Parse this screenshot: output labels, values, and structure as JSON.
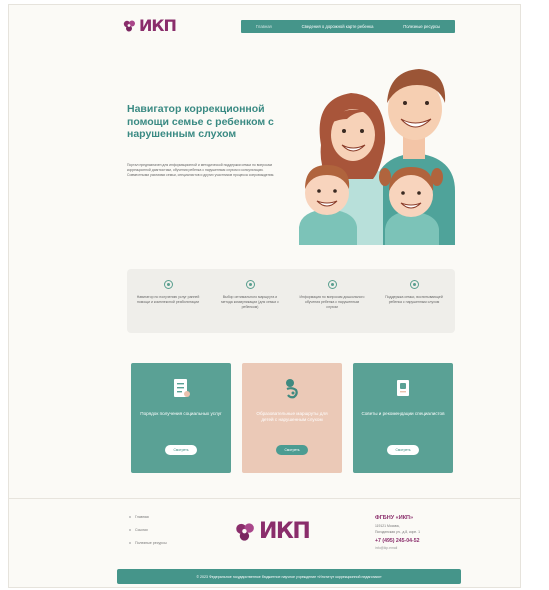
{
  "header": {
    "logo_text": "ИКП",
    "nav": [
      "Главная",
      "Сведения о дорожной карте ребенка",
      "Полезные ресурсы"
    ]
  },
  "hero": {
    "title": "Навигатор коррекционной помощи семье с ребенком с нарушенным слухом",
    "description": "Портал предназначен для информационной и методической поддержки семьи по вопросам коррекционной диагностики, обучения ребенка с нарушенным слухом и консультации. Совместными усилиями семьи, специалистов и других участников процесса сопровождения."
  },
  "features": [
    {
      "icon": "circle-check-icon",
      "text": "Навигатор по получению услуг ранней помощи и комплексной реабилитации"
    },
    {
      "icon": "circle-check-icon",
      "text": "Выбор оптимального маршрута и метода коммуникации (для семьи с ребенком)"
    },
    {
      "icon": "circle-check-icon",
      "text": "Информация по вопросам дошкольного обучения ребенка с нарушенным слухом"
    },
    {
      "icon": "circle-check-icon",
      "text": "Поддержка семьи, воспитывающей ребенка с нарушенным слухом"
    }
  ],
  "cards": [
    {
      "icon": "document-list-icon",
      "title": "Порядок получения социальных услуг",
      "button": "Смотреть"
    },
    {
      "icon": "ear-hearing-icon",
      "title": "Образовательные маршруты для детей с нарушенным слухом",
      "button": "Смотреть"
    },
    {
      "icon": "book-tips-icon",
      "title": "Советы и рекомендации специалистов",
      "button": "Смотреть"
    }
  ],
  "footer": {
    "links": [
      "Главная",
      "Ссылки",
      "Полезные ресурсы"
    ],
    "logo_text": "ИКП",
    "org_name": "ФГБНУ «ИКП»",
    "org_lines": [
      "119121 Москва,",
      "Погодинская ул., д.8, корп. 1"
    ],
    "phone": "+7 (495) 245-04-52",
    "email": "info@ikp.email",
    "copyright": "© 2023 Федеральное государственное бюджетное научное учреждение «Институт коррекционной педагогики»"
  },
  "colors": {
    "brand_purple": "#8a2d6b",
    "teal": "#45958a",
    "card_teal": "#5aa195",
    "card_peach": "#ebc9b7",
    "page_bg": "#fbfaf6"
  }
}
